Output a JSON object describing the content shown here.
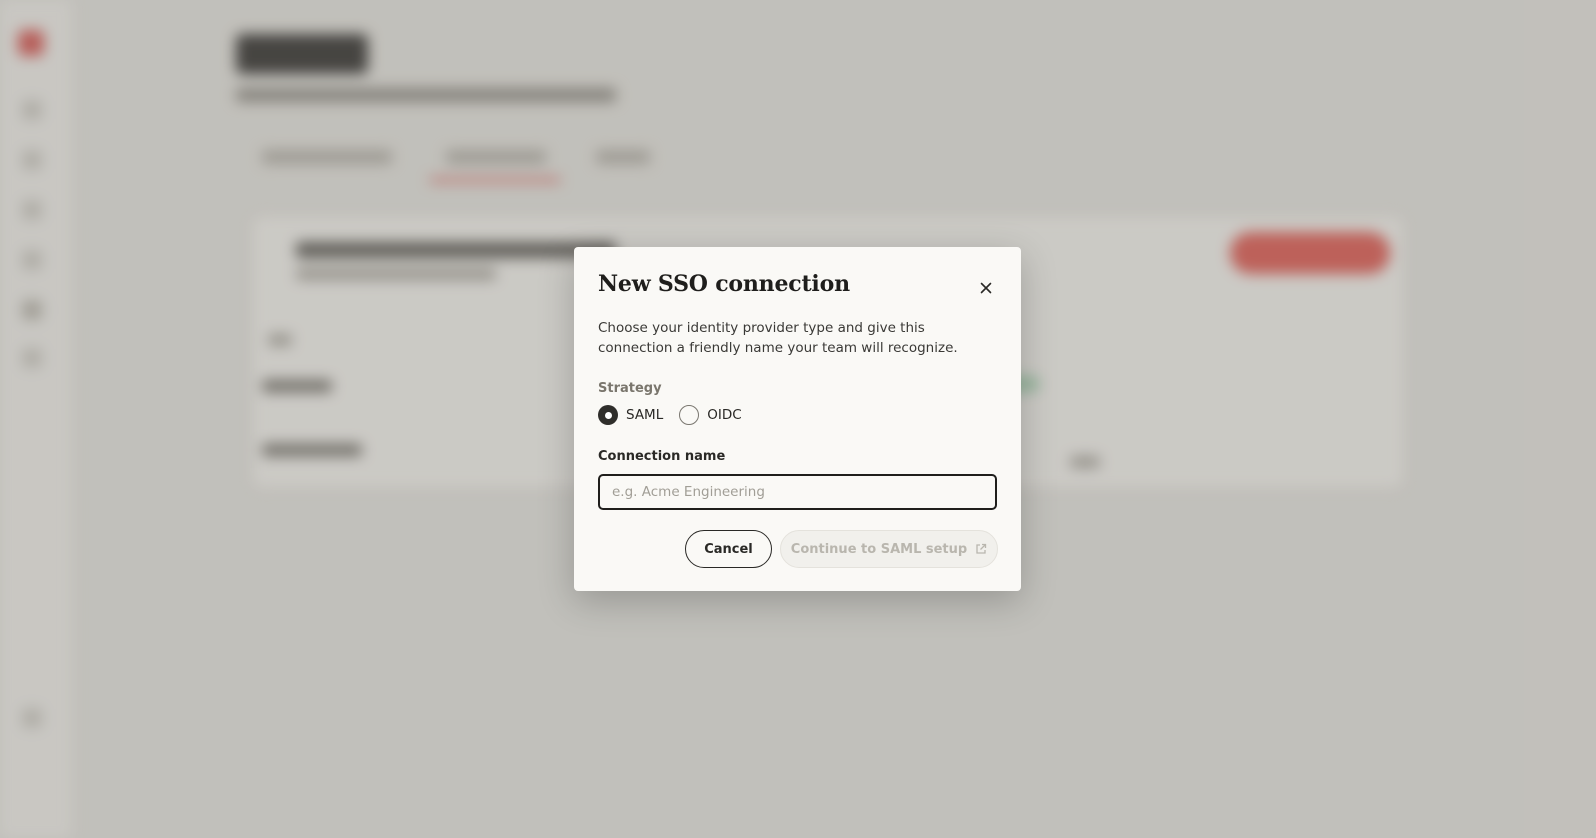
{
  "modal": {
    "title": "New SSO connection",
    "description": "Choose your identity provider type and give this connection a friendly name your team will recognize.",
    "strategy": {
      "label": "Strategy",
      "options": [
        {
          "label": "SAML",
          "selected": true
        },
        {
          "label": "OIDC",
          "selected": false
        }
      ]
    },
    "connection_name": {
      "label": "Connection name",
      "value": "",
      "placeholder": "e.g. Acme Engineering"
    },
    "buttons": {
      "cancel": "Cancel",
      "continue": "Continue to SAML setup"
    },
    "icons": {
      "close": "close-icon",
      "continue": "external-link-icon"
    }
  },
  "colors": {
    "accent": "#d9534f",
    "modal_bg": "#faf9f6",
    "text": "#1f1e1c"
  }
}
